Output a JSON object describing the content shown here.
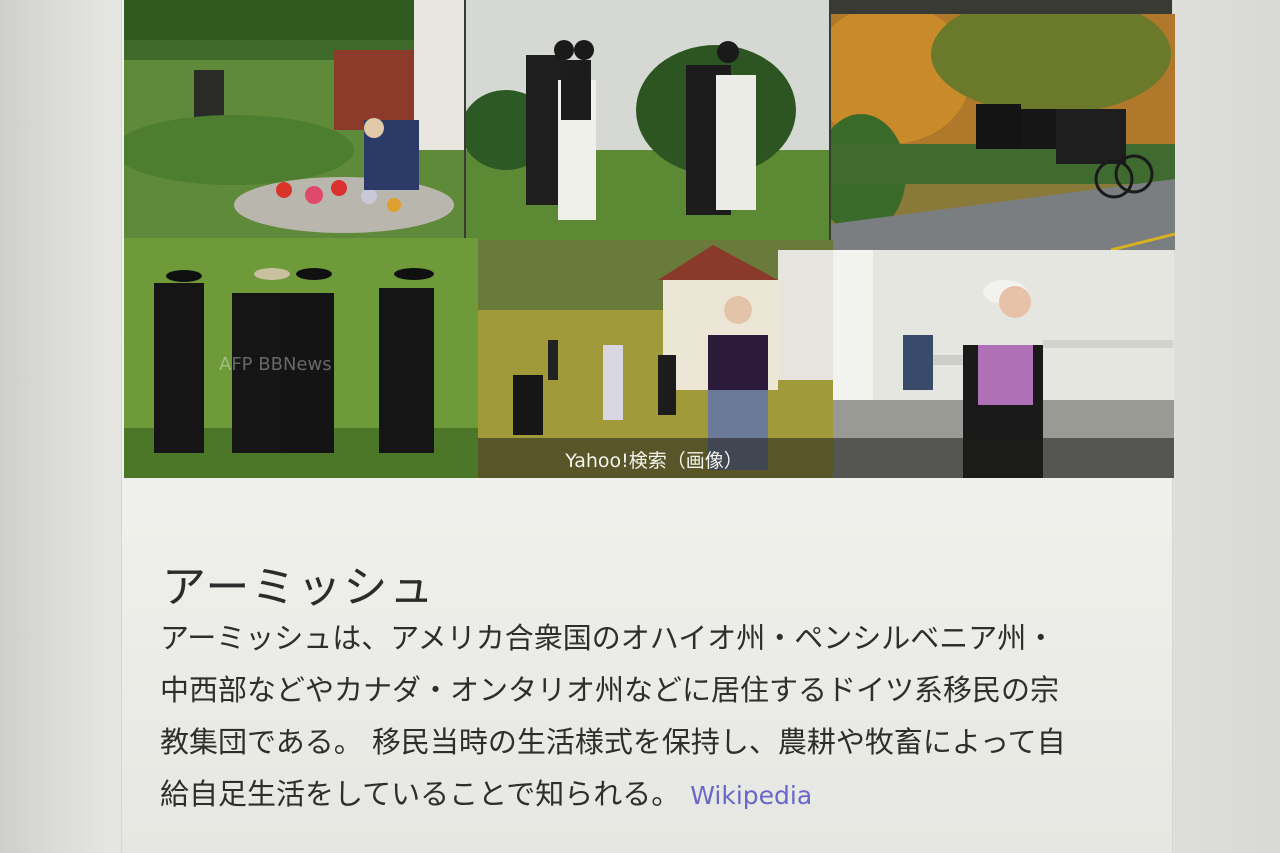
{
  "image_panel": {
    "caption": "Yahoo!検索（画像）",
    "tiles": [
      {
        "subject": "farmyard with water pump and flower bed"
      },
      {
        "subject": "women in bonnets and aprons walking"
      },
      {
        "subject": "horse-drawn buggy on road"
      },
      {
        "subject": "men in black hats walking in field",
        "watermark": "AFP BBNews"
      },
      {
        "subject": "children playing by white schoolhouse"
      },
      {
        "subject": "woman in purple dress near benches"
      }
    ]
  },
  "article": {
    "title": "アーミッシュ",
    "lines": [
      "アーミッシュは、アメリカ合衆国のオハイオ州・ペンシルベニア州・",
      "中西部などやカナダ・オンタリオ州などに居住するドイツ系移民の宗",
      "教集団である。 移民当時の生活様式を保持し、農耕や牧畜によって自",
      "給自足生活をしていることで知られる。"
    ],
    "source_link": "Wikipedia"
  },
  "colors": {
    "link": "#6a67c8",
    "text": "#2e2e2e",
    "background": "#ecede8"
  }
}
